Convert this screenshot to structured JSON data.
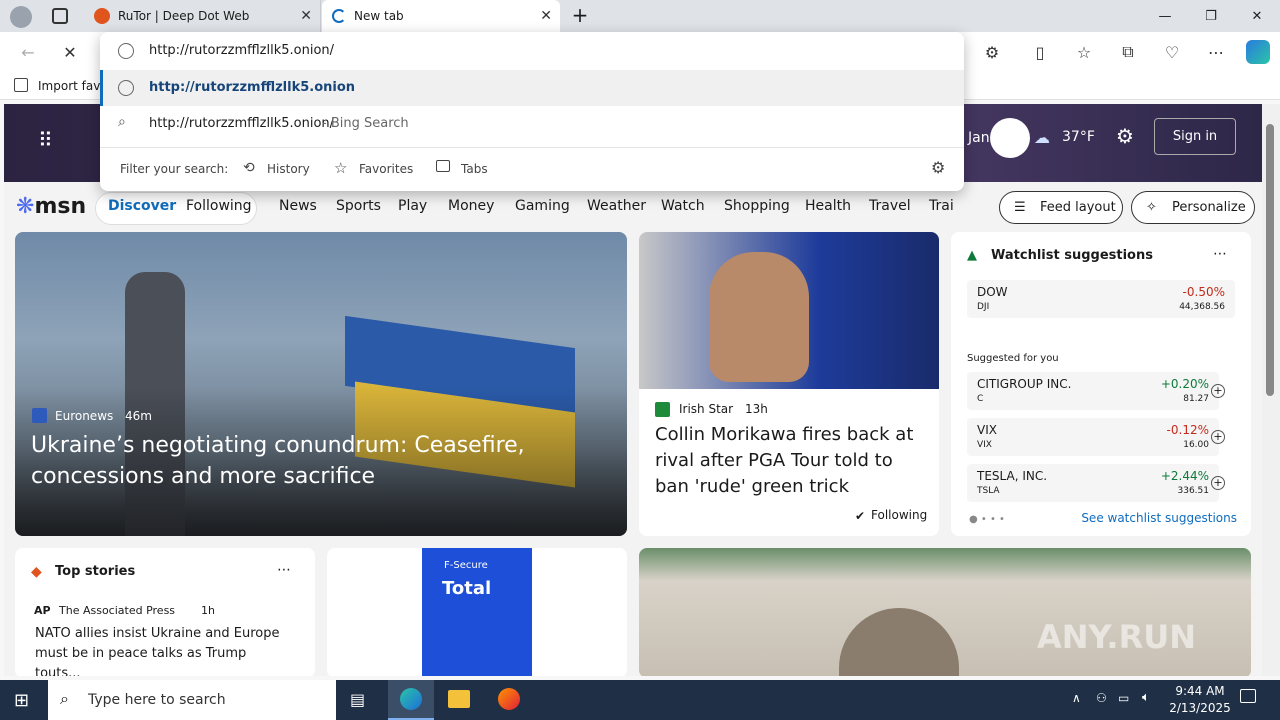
{
  "tabs": [
    {
      "title": "RuTor | Deep Dot Web"
    },
    {
      "title": "New tab"
    }
  ],
  "address": {
    "value": "http://rutorzzmfflzllk5.onion/"
  },
  "suggestions": [
    {
      "text": "http://rutorzzmfflzllk5.onion"
    },
    {
      "text": "http://rutorzzmfflzllk5.onion/",
      "suffix": " - Bing Search"
    }
  ],
  "filter": {
    "label": "Filter your search:",
    "history": "History",
    "favorites": "Favorites",
    "tabs": "Tabs"
  },
  "favbar": {
    "import": "Import favo"
  },
  "hero": {
    "user": "Jan",
    "temp": "37°F",
    "signin": "Sign in"
  },
  "msn": {
    "logo": "msn"
  },
  "nav": [
    "Discover",
    "Following",
    "News",
    "Sports",
    "Play",
    "Money",
    "Gaming",
    "Weather",
    "Watch",
    "Shopping",
    "Health",
    "Travel",
    "Trai"
  ],
  "buttons": {
    "feed": "Feed layout",
    "personalize": "Personalize"
  },
  "lead": {
    "source": "Euronews",
    "age": "46m",
    "title": "Ukraine’s negotiating conundrum: Ceasefire, concessions and more sacrifice"
  },
  "story2": {
    "source": "Irish Star",
    "age": "13h",
    "title": "Collin Morikawa fires back at rival after PGA Tour told to ban 'rude' green trick",
    "following": "Following"
  },
  "watchlist": {
    "title": "Watchlist suggestions",
    "dow": {
      "name": "DOW",
      "ticker": "DJI",
      "change": "-0.50%",
      "value": "44,368.56"
    },
    "suggested": "Suggested for you",
    "items": [
      {
        "name": "CITIGROUP INC.",
        "ticker": "C",
        "change": "+0.20%",
        "value": "81.27"
      },
      {
        "name": "VIX",
        "ticker": "VIX",
        "change": "-0.12%",
        "value": "16.00"
      },
      {
        "name": "TESLA, INC.",
        "ticker": "TSLA",
        "change": "+2.44%",
        "value": "336.51"
      }
    ],
    "see": "See watchlist suggestions"
  },
  "topstories": {
    "title": "Top stories",
    "source": "The Associated Press",
    "age": "1h",
    "headline": "NATO allies insist Ukraine and Europe must be in peace talks as Trump touts..."
  },
  "ad": {
    "brand": "F-Secure",
    "product": "Total"
  },
  "taskbar": {
    "search": "Type here to search",
    "time": "9:44 AM",
    "date": "2/13/2025"
  },
  "watermark": "ANY.RUN",
  "colors": {
    "up": "#0d7a3a",
    "down": "#c42b1c",
    "accent": "#0f6cbd"
  }
}
